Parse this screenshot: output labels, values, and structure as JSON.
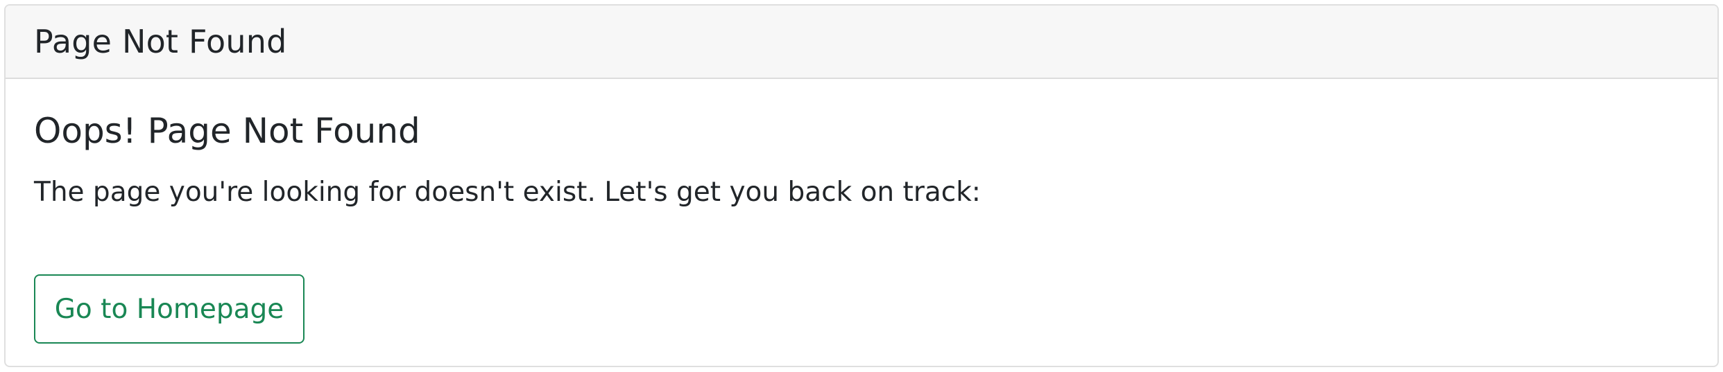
{
  "card": {
    "header_title": "Page Not Found",
    "heading": "Oops! Page Not Found",
    "message": "The page you're looking for doesn't exist. Let's get you back on track:",
    "home_button_label": "Go to Homepage"
  },
  "colors": {
    "header_background": "#f7f7f7",
    "border": "#dfdfdf",
    "text": "#212529",
    "button_accent": "#198754"
  }
}
